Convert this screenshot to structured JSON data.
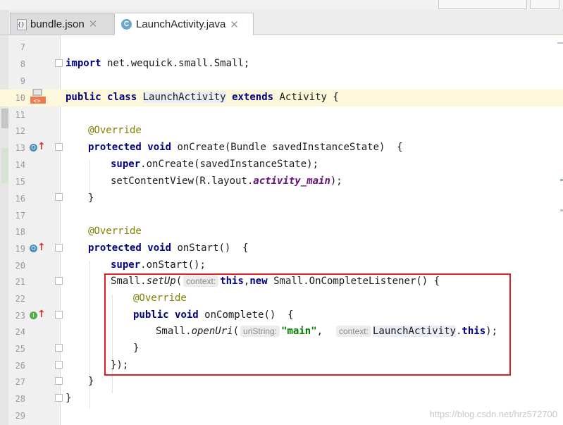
{
  "tabs": [
    {
      "label": "bundle.json",
      "icon": "json-file-icon",
      "active": false
    },
    {
      "label": "LaunchActivity.java",
      "icon": "java-class-icon",
      "active": true
    }
  ],
  "close_glyph": "✕",
  "class_icon_letter": "C",
  "gutter_icons": {
    "override_letter": "O",
    "implement_letter": "I",
    "arrow_up": "↑"
  },
  "lines": {
    "n7": "7",
    "n8": "8",
    "n9": "9",
    "n10": "10",
    "n11": "11",
    "n12": "12",
    "n13": "13",
    "n14": "14",
    "n15": "15",
    "n16": "16",
    "n17": "17",
    "n18": "18",
    "n19": "19",
    "n20": "20",
    "n21": "21",
    "n22": "22",
    "n23": "23",
    "n24": "24",
    "n25": "25",
    "n26": "26",
    "n27": "27",
    "n28": "28",
    "n29": "29"
  },
  "code": {
    "import_kw": "import",
    "import_pkg": " net.wequick.small.Small;",
    "public": "public",
    "class": "class",
    "class_name": "LaunchActivity",
    "extends": "extends",
    "parent": " Activity {",
    "override": "@Override",
    "protected": "protected",
    "void": "void",
    "on_create": " onCreate(Bundle savedInstanceState)  {",
    "super": "super",
    "on_create_call": ".onCreate(savedInstanceState);",
    "set_content": "setContentView(R.layout.",
    "activity_main": "activity_main",
    "set_content_end": ");",
    "close_brace": "}",
    "on_start": " onStart()  {",
    "on_start_call": ".onStart();",
    "small_dot": "Small.",
    "setup": "setUp",
    "paren_open": "(",
    "hint_context": "context:",
    "this_kw": "this",
    "comma": ",",
    "new_kw": "new",
    "listener": " Small.OnCompleteListener() {",
    "on_complete": " onComplete()  {",
    "open_uri": "openUri",
    "hint_uri": "uriString:",
    "main_str": "\"main\"",
    "comma_space": ",  ",
    "launch_ref": "LaunchActivity",
    "this_tail": ".",
    "end_call": ");",
    "close_setup": "});"
  },
  "watermark": "https://blog.csdn.net/hrz572700",
  "colors": {
    "keyword": "#000080",
    "annotation": "#808000",
    "field": "#660e7a",
    "string": "#008000",
    "highlight_box": "#e51c23",
    "current_line": "#fdf8dc"
  }
}
